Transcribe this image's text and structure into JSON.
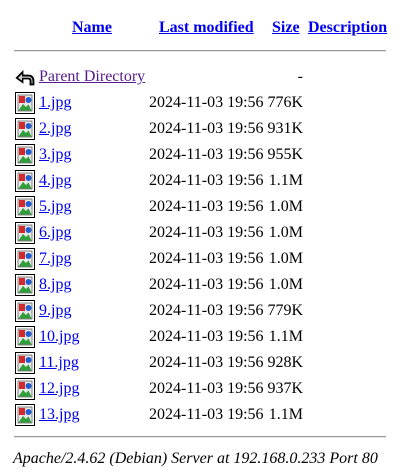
{
  "header": {
    "name": "Name",
    "last_modified": "Last modified",
    "size": "Size",
    "description": "Description"
  },
  "parent": {
    "label": "Parent Directory",
    "size": "-",
    "icon": "back-icon"
  },
  "files": [
    {
      "name": "1.jpg",
      "date": "2024-11-03 19:56",
      "size": "776K",
      "icon": "image-file-icon"
    },
    {
      "name": "2.jpg",
      "date": "2024-11-03 19:56",
      "size": "931K",
      "icon": "image-file-icon"
    },
    {
      "name": "3.jpg",
      "date": "2024-11-03 19:56",
      "size": "955K",
      "icon": "image-file-icon"
    },
    {
      "name": "4.jpg",
      "date": "2024-11-03 19:56",
      "size": "1.1M",
      "icon": "image-file-icon"
    },
    {
      "name": "5.jpg",
      "date": "2024-11-03 19:56",
      "size": "1.0M",
      "icon": "image-file-icon"
    },
    {
      "name": "6.jpg",
      "date": "2024-11-03 19:56",
      "size": "1.0M",
      "icon": "image-file-icon"
    },
    {
      "name": "7.jpg",
      "date": "2024-11-03 19:56",
      "size": "1.0M",
      "icon": "image-file-icon"
    },
    {
      "name": "8.jpg",
      "date": "2024-11-03 19:56",
      "size": "1.0M",
      "icon": "image-file-icon"
    },
    {
      "name": "9.jpg",
      "date": "2024-11-03 19:56",
      "size": "779K",
      "icon": "image-file-icon"
    },
    {
      "name": "10.jpg",
      "date": "2024-11-03 19:56",
      "size": "1.1M",
      "icon": "image-file-icon"
    },
    {
      "name": "11.jpg",
      "date": "2024-11-03 19:56",
      "size": "928K",
      "icon": "image-file-icon"
    },
    {
      "name": "12.jpg",
      "date": "2024-11-03 19:56",
      "size": "937K",
      "icon": "image-file-icon"
    },
    {
      "name": "13.jpg",
      "date": "2024-11-03 19:56",
      "size": "1.1M",
      "icon": "image-file-icon"
    }
  ],
  "footer": {
    "text": "Apache/2.4.62 (Debian) Server at 192.168.0.233 Port 80"
  },
  "colors": {
    "link": "#0000ee",
    "visited_link": "#551a8b",
    "rule": "#9a9a9a"
  }
}
